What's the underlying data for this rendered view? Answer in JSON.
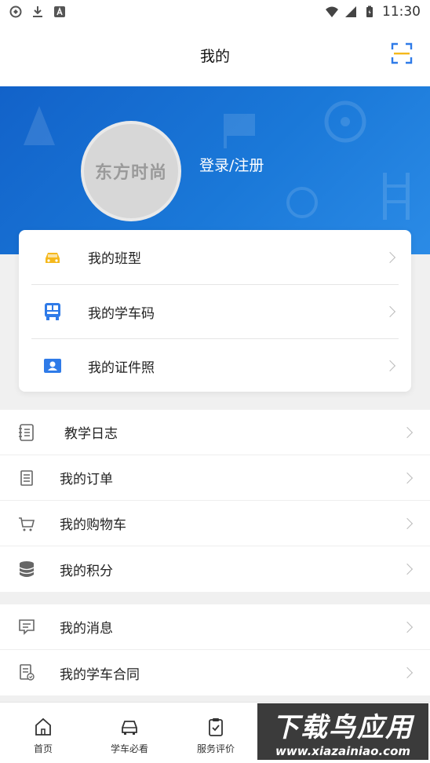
{
  "status_bar": {
    "time": "11:30"
  },
  "header": {
    "title": "我的"
  },
  "profile": {
    "avatar_text": "东方时尚",
    "login_label": "登录/注册"
  },
  "card_items": [
    {
      "label": "我的班型",
      "icon": "car-icon"
    },
    {
      "label": "我的学车码",
      "icon": "qr-bus-icon"
    },
    {
      "label": "我的证件照",
      "icon": "id-photo-icon"
    }
  ],
  "list_group_1": [
    {
      "label": "教学日志",
      "icon": "notebook-icon"
    },
    {
      "label": "我的订单",
      "icon": "order-icon"
    },
    {
      "label": "我的购物车",
      "icon": "cart-icon"
    },
    {
      "label": "我的积分",
      "icon": "coins-icon"
    }
  ],
  "list_group_2": [
    {
      "label": "我的消息",
      "icon": "message-icon"
    },
    {
      "label": "我的学车合同",
      "icon": "contract-icon"
    }
  ],
  "tabs": [
    {
      "label": "首页",
      "icon": "home-icon"
    },
    {
      "label": "学车必看",
      "icon": "car-outline-icon"
    },
    {
      "label": "服务评价",
      "icon": "clipboard-check-icon"
    }
  ],
  "watermark": {
    "title": "下载鸟应用",
    "url": "www.xiazainiao.com"
  },
  "colors": {
    "accent_blue": "#1a78d8",
    "accent_yellow": "#f5b81c",
    "icon_blue": "#2f7be8"
  }
}
